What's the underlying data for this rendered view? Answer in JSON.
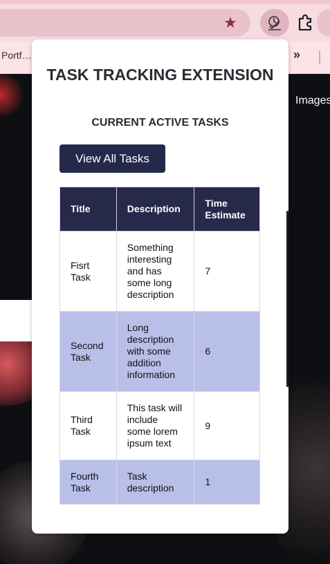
{
  "browser": {
    "bookmark_label": "Portf…",
    "overflow_label": "»",
    "star_glyph": "★"
  },
  "page": {
    "images_label": "Images"
  },
  "popup": {
    "title": "TASK TRACKING EXTENSION",
    "subtitle": "CURRENT ACTIVE TASKS",
    "view_all_button": "View All Tasks",
    "table": {
      "headers": [
        "Title",
        "Description",
        "Time Estimate"
      ],
      "rows": [
        {
          "title": "Fisrt Task",
          "description": "Something interesting and has some long description",
          "time": "7"
        },
        {
          "title": "Second Task",
          "description": "Long description with some addition information",
          "time": "6"
        },
        {
          "title": "Third Task",
          "description": "This task will include some lorem ipsum text",
          "time": "9"
        },
        {
          "title": "Fourth Task",
          "description": "Task description",
          "time": "1"
        }
      ]
    }
  },
  "colors": {
    "header_bg": "#27294b",
    "button_bg": "#24284a",
    "alt_row_bg": "#b8bfe9",
    "chrome_bg": "#f6dbe1"
  },
  "icons": {
    "star": "bookmark-star-icon",
    "extension": "task-extension-icon",
    "puzzle": "extensions-puzzle-icon"
  }
}
